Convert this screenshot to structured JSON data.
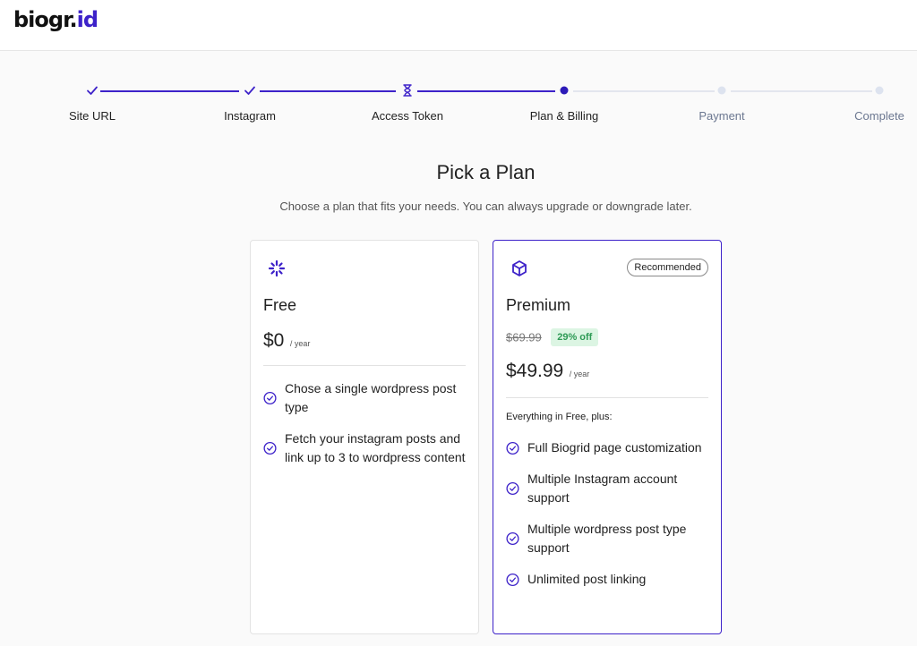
{
  "brand": {
    "logo_main": "biogr",
    "logo_sep": ".",
    "logo_accent": "id",
    "accent_color": "#3d22c9"
  },
  "stepper": {
    "steps": [
      {
        "label": "Site URL",
        "state": "done",
        "icon": "check-icon"
      },
      {
        "label": "Instagram",
        "state": "done",
        "icon": "check-icon"
      },
      {
        "label": "Access Token",
        "state": "in-progress",
        "icon": "hourglass-icon"
      },
      {
        "label": "Plan & Billing",
        "state": "active"
      },
      {
        "label": "Payment",
        "state": "todo"
      },
      {
        "label": "Complete",
        "state": "todo"
      }
    ]
  },
  "page": {
    "title": "Pick a Plan",
    "subtitle": "Choose a plan that fits your needs. You can always upgrade or downgrade later."
  },
  "plans": {
    "free": {
      "icon": "sparkle-icon",
      "name": "Free",
      "price": "$0",
      "period": "/ year",
      "features": [
        "Chose a single wordpress post type",
        "Fetch your instagram posts and link up to 3 to wordpress content"
      ]
    },
    "premium": {
      "icon": "cube-icon",
      "badge": "Recommended",
      "name": "Premium",
      "old_price": "$69.99",
      "discount": "29% off",
      "price": "$49.99",
      "period": "/ year",
      "intro": "Everything in Free, plus:",
      "features": [
        "Full Biogrid page customization",
        "Multiple Instagram account support",
        "Multiple wordpress post type support",
        "Unlimited post linking"
      ]
    }
  }
}
